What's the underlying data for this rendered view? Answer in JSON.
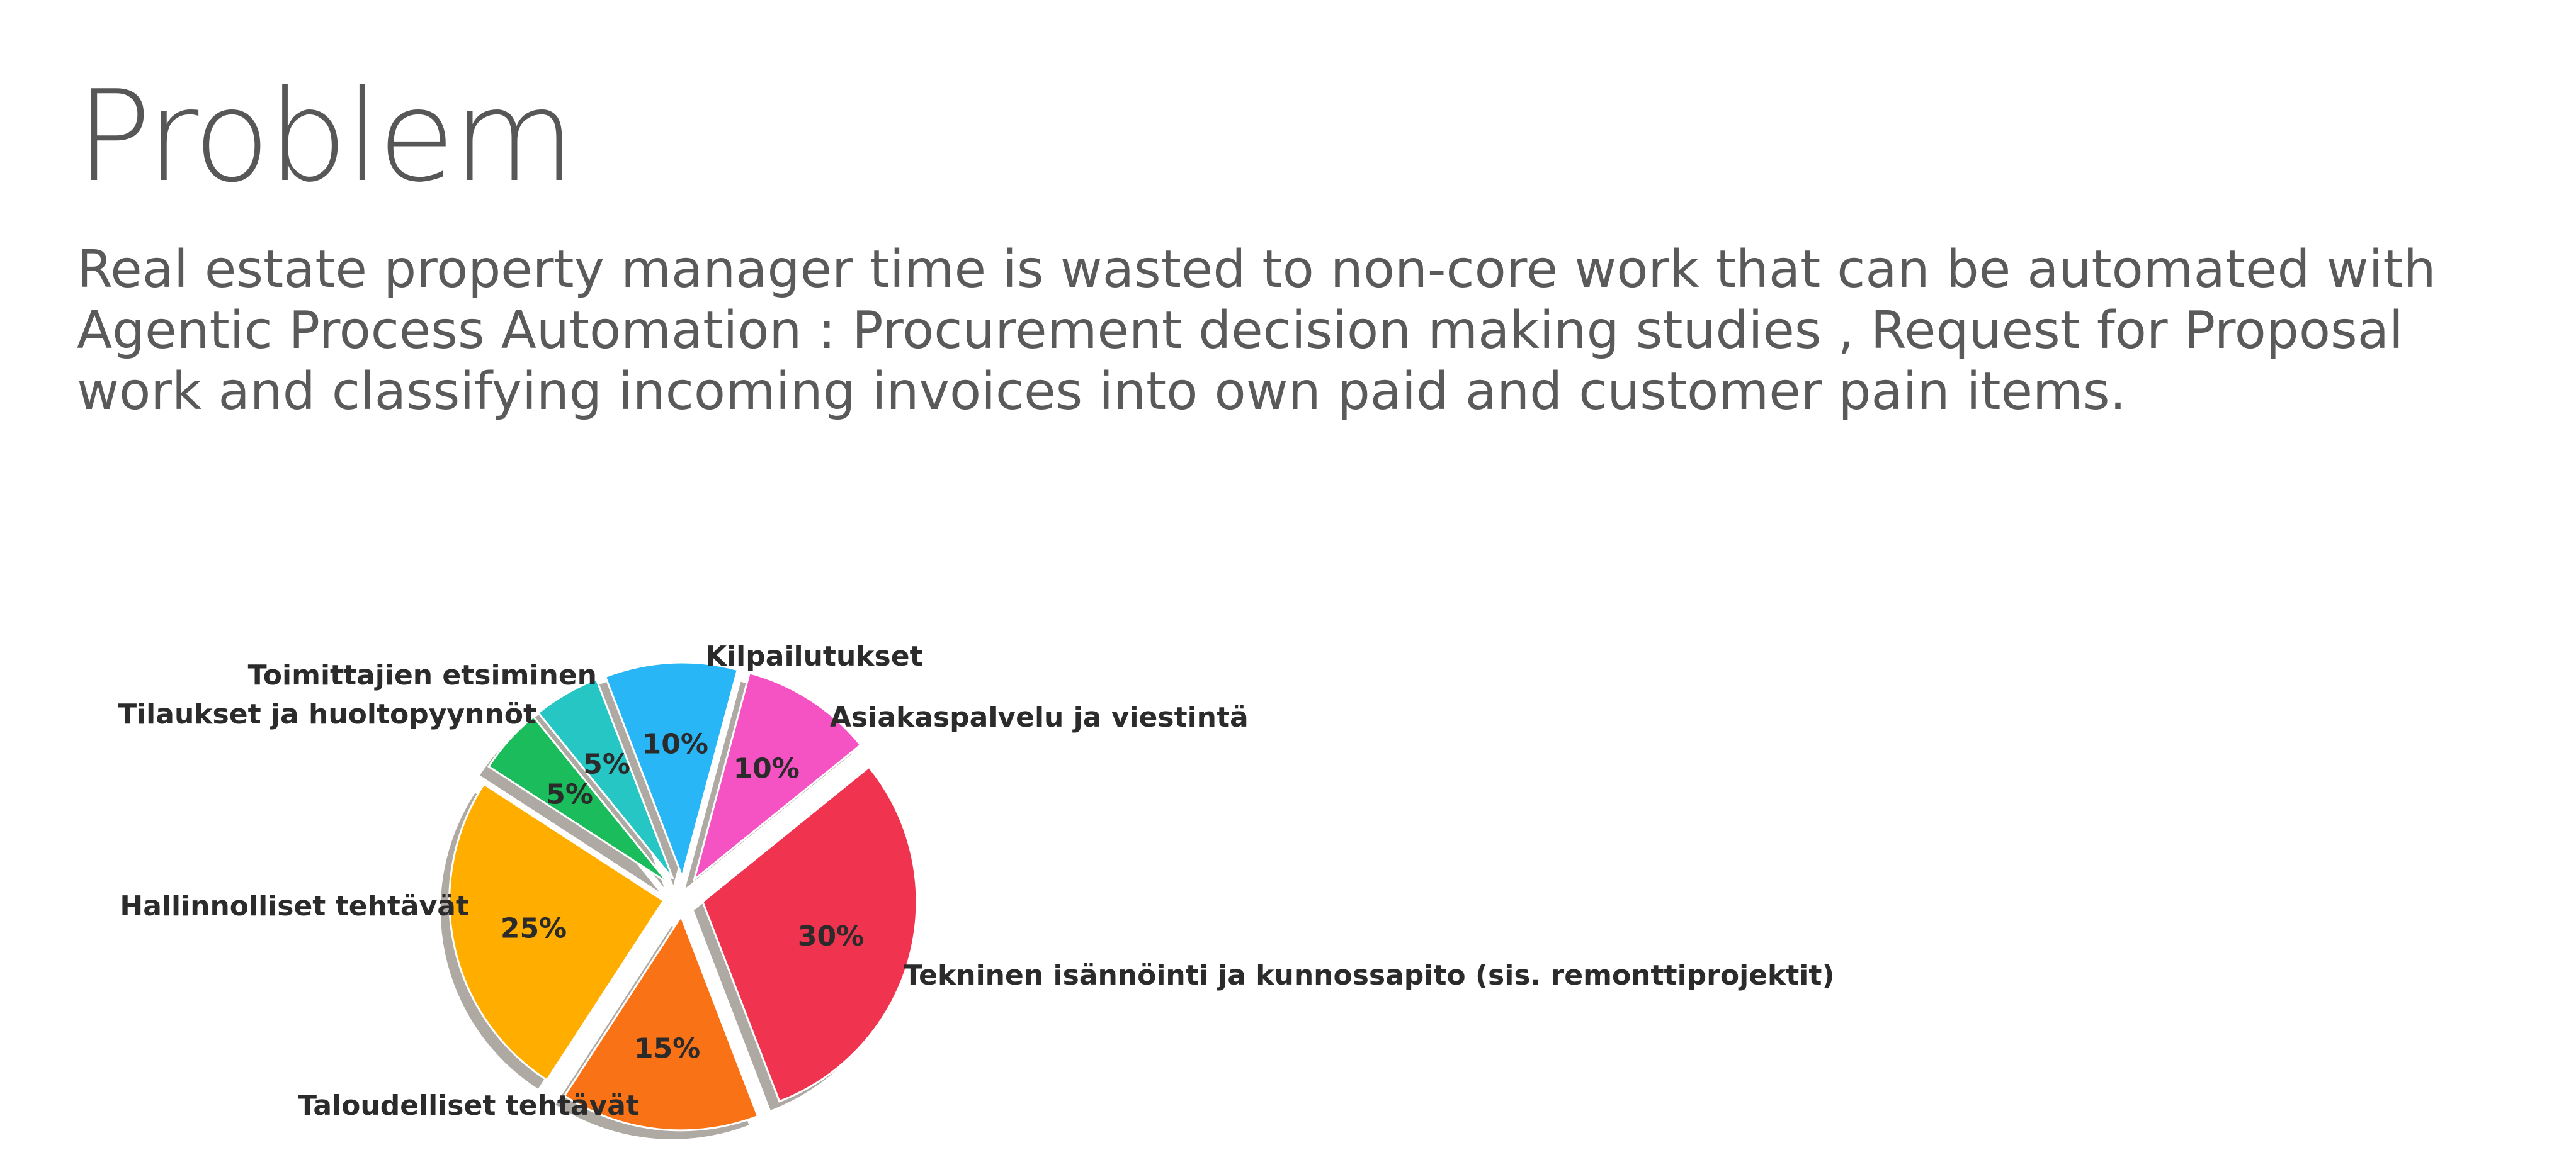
{
  "slide": {
    "title": "Problem",
    "body": "Real estate property manager time is wasted to non-core work that can be automated with Agentic Process Automation : Procurement decision making studies , Request for Proposal work and classifying incoming invoices into own paid and customer pain items."
  },
  "chart_data": {
    "type": "pie",
    "title": "",
    "exploded": true,
    "shadow": true,
    "categories": [
      "Kilpailutukset",
      "Toimittajien etsiminen",
      "Tilaukset ja huoltopyynnöt",
      "Hallinnolliset tehtävät",
      "Taloudelliset tehtävät",
      "Tekninen isännöinti ja kunnossapito (sis. remonttiprojektit)",
      "Asiakaspalvelu ja viestintä"
    ],
    "values": [
      10,
      5,
      5,
      25,
      15,
      30,
      10
    ],
    "value_labels": [
      "10%",
      "5%",
      "5%",
      "25%",
      "15%",
      "30%",
      "10%"
    ],
    "colors": [
      "#29b6f6",
      "#26c6c4",
      "#1abc5c",
      "#ffae00",
      "#f97316",
      "#f0334f",
      "#f552c4"
    ]
  }
}
